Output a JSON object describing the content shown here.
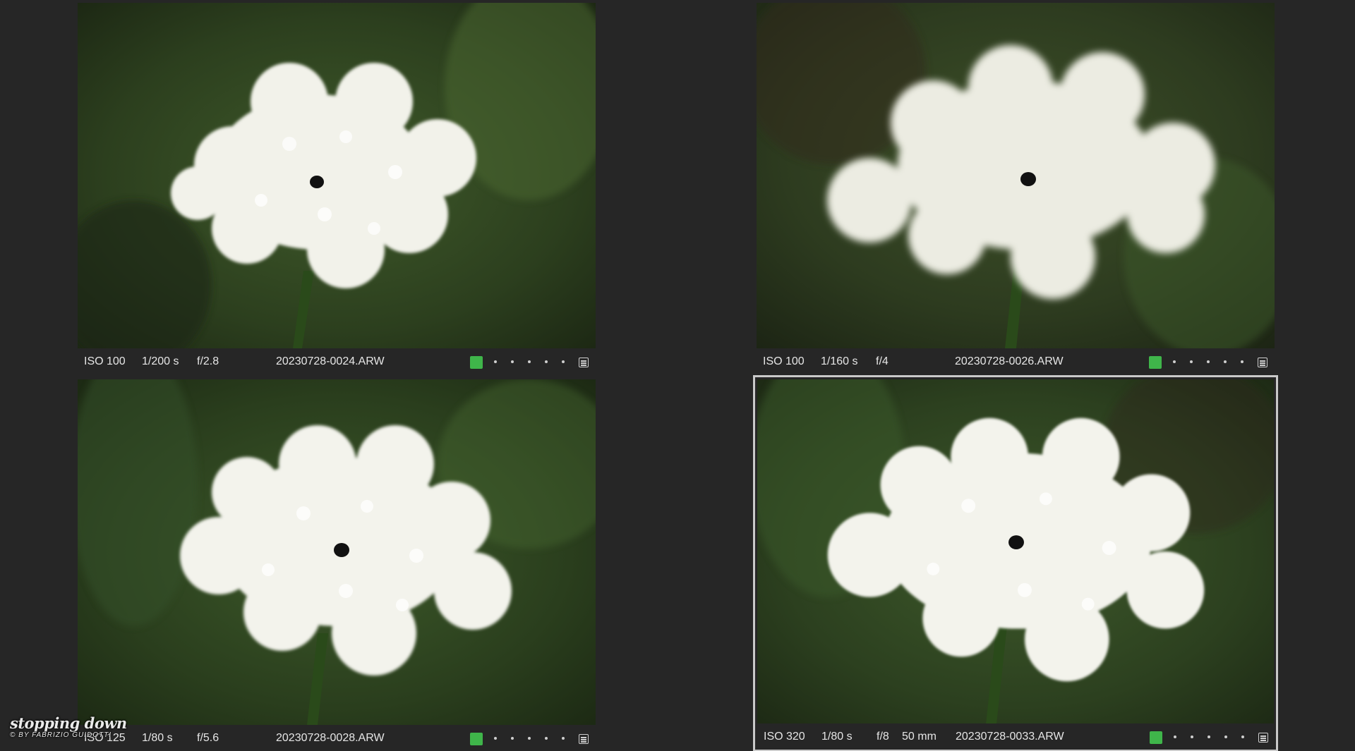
{
  "browser": {
    "cells": [
      {
        "iso": "ISO 100",
        "shutter": "1/200 s",
        "aperture": "f/2.8",
        "focal": "",
        "filename": "20230728-0024.ARW",
        "color_label": "#3fb54a",
        "selected": false
      },
      {
        "iso": "ISO 100",
        "shutter": "1/160 s",
        "aperture": "f/4",
        "focal": "",
        "filename": "20230728-0026.ARW",
        "color_label": "#3fb54a",
        "selected": false
      },
      {
        "iso": "ISO 125",
        "shutter": "1/80 s",
        "aperture": "f/5.6",
        "focal": "",
        "filename": "20230728-0028.ARW",
        "color_label": "#3fb54a",
        "selected": false
      },
      {
        "iso": "ISO 320",
        "shutter": "1/80 s",
        "aperture": "f/8",
        "focal": "50 mm",
        "filename": "20230728-0033.ARW",
        "color_label": "#3fb54a",
        "selected": true
      }
    ]
  },
  "watermark": {
    "title": "stopping down",
    "subtitle": "© BY FABRIZIO GUIDOTTI"
  },
  "colors": {
    "background": "#262626",
    "selection_border": "#c9c9c9",
    "green_label": "#3fb54a"
  }
}
